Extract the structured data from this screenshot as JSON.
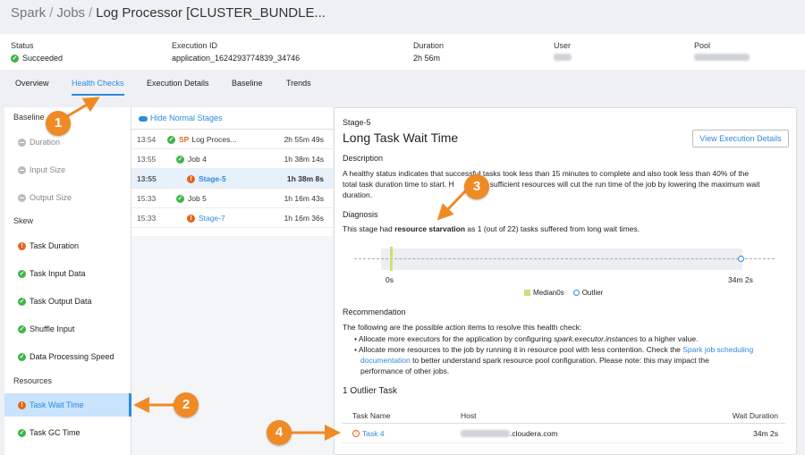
{
  "breadcrumb": {
    "items": [
      "Spark",
      "Jobs",
      "Log Processor [CLUSTER_BUNDLE..."
    ]
  },
  "summary": {
    "status_label": "Status",
    "status_value": "Succeeded",
    "exec_label": "Execution ID",
    "exec_value": "application_1624293774839_34746",
    "duration_label": "Duration",
    "duration_value": "2h 56m",
    "user_label": "User",
    "pool_label": "Pool"
  },
  "tabs": [
    "Overview",
    "Health Checks",
    "Execution Details",
    "Baseline",
    "Trends"
  ],
  "left_panel": {
    "baseline_heading": "Baseline",
    "baseline_items": [
      "Duration",
      "Input Size",
      "Output Size"
    ],
    "skew_heading": "Skew",
    "skew_items": [
      "Task Duration",
      "Task Input Data",
      "Task Output Data",
      "Shuffle Input",
      "Data Processing Speed"
    ],
    "resources_heading": "Resources",
    "resources_items": [
      "Task Wait Time",
      "Task GC Time"
    ]
  },
  "middle_panel": {
    "toggle_label": "Hide Normal Stages",
    "rows": [
      {
        "time": "13:54",
        "prefix": "SP",
        "name": "Log Proces...",
        "duration": "2h 55m 49s"
      },
      {
        "time": "13:55",
        "name": "Job 4",
        "duration": "1h 38m 14s"
      },
      {
        "time": "13:55",
        "name": "Stage-5",
        "duration": "1h 38m 8s"
      },
      {
        "time": "15:33",
        "name": "Job 5",
        "duration": "1h 16m 43s"
      },
      {
        "time": "15:33",
        "name": "Stage-7",
        "duration": "1h 16m 36s"
      }
    ]
  },
  "detail": {
    "stage": "Stage-5",
    "title": "Long Task Wait Time",
    "view_button": "View Execution Details",
    "desc_heading": "Description",
    "desc_line1": "A healthy status indicates that successful tasks took less than 15 minutes to complete and also took less than 40% of the",
    "desc_line2": "total task duration time to start. H",
    "desc_line2b": "sufficient resources will cut the run time of the job by lowering the maximum wait",
    "desc_line3": "duration.",
    "diag_heading": "Diagnosis",
    "diag_pre": "This stage had ",
    "diag_bold": "resource starvation",
    "diag_post": " as 1 (out of 22) tasks suffered from long wait times.",
    "axis_min": "0s",
    "axis_max": "34m 2s",
    "legend_median": "Median0s",
    "legend_outlier": "Outlier",
    "rec_heading": "Recommendation",
    "rec_intro": "The following are the possible action items to resolve this health check:",
    "rec1_pre": "Allocate more executors for the application by configuring ",
    "rec1_em": "spark.executor.instances",
    "rec1_post": " to a higher value.",
    "rec2_pre": "Allocate more resources to the job by running it in resource pool with less contention. Check the ",
    "rec2_link1": "Spark job scheduling",
    "rec2_link2": "documentation",
    "rec2_post": " to better understand spark resource pool configuration. Please note: this may impact the",
    "rec2_post2": "performance of other jobs.",
    "outlier_heading": "1 Outlier Task",
    "table_headers": [
      "Task Name",
      "Host",
      "Wait Duration"
    ],
    "table_row": {
      "task": "Task 4",
      "host_suffix": ".cloudera.com",
      "wait": "34m 2s"
    }
  },
  "callouts": [
    "1",
    "2",
    "3",
    "4"
  ],
  "colors": {
    "accent": "#2d8ae0",
    "callout": "#f08a24",
    "ok": "#3fb549",
    "warn": "#e8641b"
  }
}
